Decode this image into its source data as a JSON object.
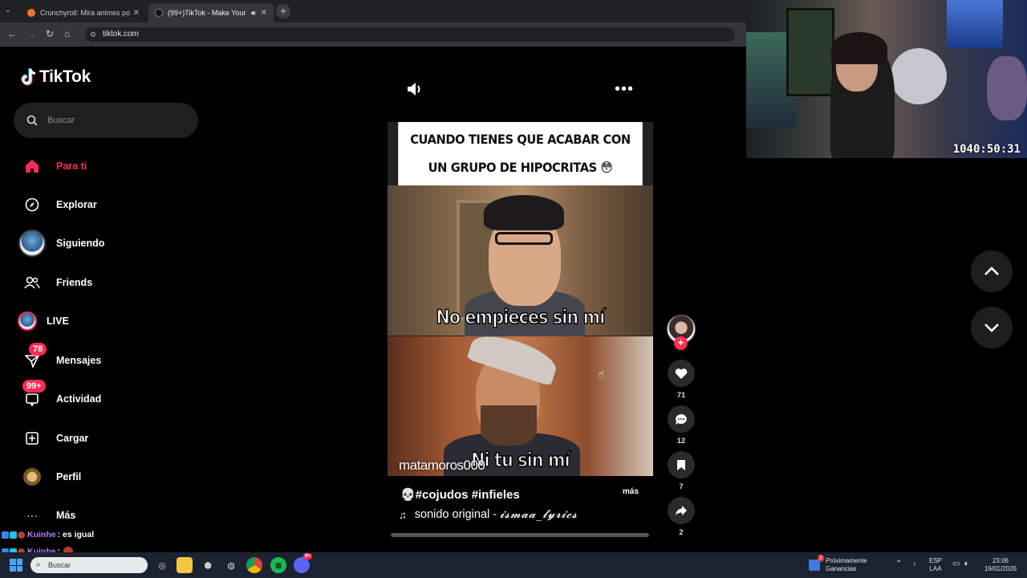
{
  "browser": {
    "tabs": [
      {
        "title": "Crunchyroll: Mira animes popula",
        "favicon_color": "#f47521"
      },
      {
        "title": "(99+)TikTok - Make Your Da",
        "favicon_color": "#111111"
      }
    ],
    "new_tab_symbol": "+",
    "url": "tiktok.com"
  },
  "sidebar": {
    "logo_text": "TikTok",
    "search_placeholder": "Buscar",
    "items": [
      {
        "label": "Para ti",
        "icon": "home-icon"
      },
      {
        "label": "Explorar",
        "icon": "compass-icon"
      },
      {
        "label": "Siguiendo",
        "icon": "avatar"
      },
      {
        "label": "Friends",
        "icon": "friends-icon"
      },
      {
        "label": "LIVE",
        "icon": "avatar"
      },
      {
        "label": "Mensajes",
        "icon": "inbox-icon",
        "badge": "78"
      },
      {
        "label": "Actividad",
        "icon": "activity-icon",
        "badge": "99+"
      },
      {
        "label": "Cargar",
        "icon": "upload-icon"
      },
      {
        "label": "Perfil",
        "icon": "profile-avatar"
      },
      {
        "label": "Más",
        "icon": "more-icon"
      }
    ]
  },
  "chat": [
    {
      "user": "Kuinhe",
      "message": ": es igual"
    },
    {
      "user": "Kuinhe",
      "message": ":"
    }
  ],
  "video": {
    "caption_line1": "CUANDO TIENES QUE ACABAR CON",
    "caption_line2": "UN GRUPO DE HIPOCRITAS 😳",
    "meme_text_top": "No empieces sin mí",
    "meme_text_bottom": "Ni tu sin mí",
    "watermark": "matamoros000",
    "description": "💀#cojudos #infieles",
    "more_label": "más",
    "music_prefix": "sonido original -",
    "music_artist": "𝓲𝓼𝓶𝓪𝓪_𝓵𝔂𝓻𝓲𝓬𝓼",
    "progress": 0.0
  },
  "actions": {
    "likes": "71",
    "comments": "12",
    "saves": "7",
    "shares": "2",
    "follow_symbol": "+"
  },
  "webcam": {
    "timer": "1040:50:31"
  },
  "taskbar": {
    "search_placeholder": "Buscar",
    "weather_line1": "Próximamente",
    "weather_line2": "Ganancias",
    "weather_badge": "2",
    "lang_line1": "ESP",
    "lang_line2": "LAA",
    "time": "23:06",
    "date": "19/01/2026",
    "discord_badge": "9+"
  },
  "colors": {
    "accent": "#fe2c55",
    "background": "#000000",
    "chat_user": "#b47cff"
  }
}
